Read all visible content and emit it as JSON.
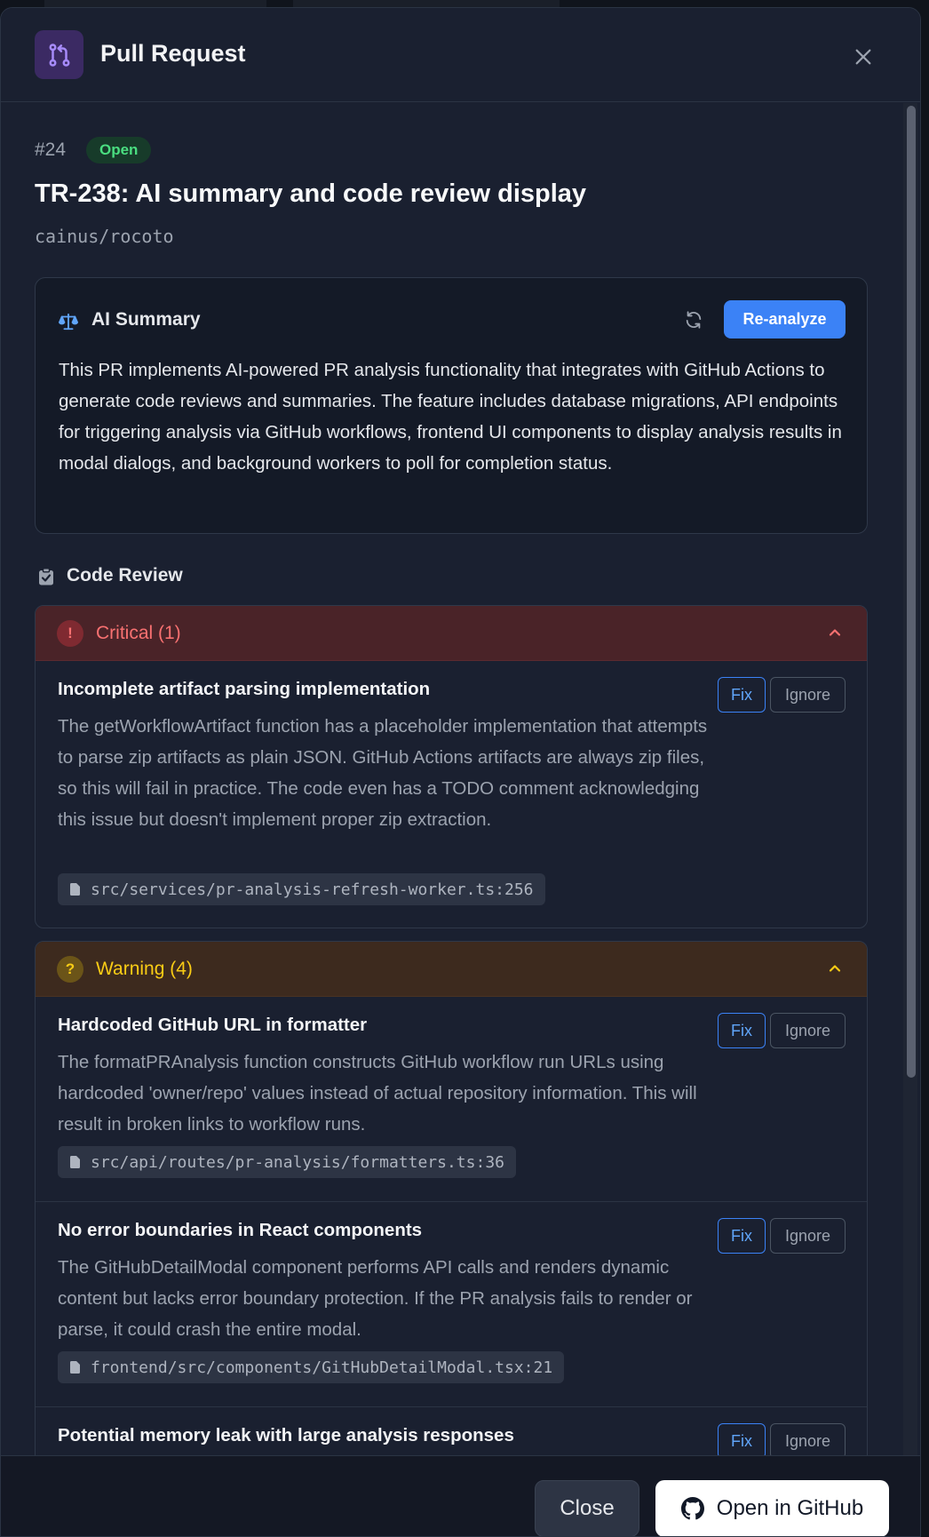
{
  "colors": {
    "accent": "#3b82f6",
    "critical": "#f87171",
    "warning": "#facc15",
    "open_badge": "#4ade80",
    "modal_bg": "#1a2030"
  },
  "header": {
    "title": "Pull Request",
    "icon": "git-pull-request-icon",
    "close_icon": "close-icon"
  },
  "pr": {
    "number": "#24",
    "status": "Open",
    "title": "TR-238: AI summary and code review display",
    "repo": "cainus/rocoto"
  },
  "ai_summary": {
    "icon": "scale-icon",
    "title": "AI Summary",
    "refresh_icon": "refresh-icon",
    "reanalyze_label": "Re-analyze",
    "text": "This PR implements AI-powered PR analysis functionality that integrates with GitHub Actions to generate code reviews and summaries. The feature includes database migrations, API endpoints for triggering analysis via GitHub workflows, frontend UI components to display analysis results in modal dialogs, and background workers to poll for completion status."
  },
  "code_review": {
    "icon": "clipboard-check-icon",
    "title": "Code Review",
    "groups": [
      {
        "severity": "critical",
        "label": "Critical (1)",
        "symbol": "!",
        "issues": [
          {
            "title": "Incomplete artifact parsing implementation",
            "description": "The getWorkflowArtifact function has a placeholder implementation that attempts to parse zip artifacts as plain JSON. GitHub Actions artifacts are always zip files, so this will fail in practice. The code even has a TODO comment acknowledging this issue but doesn't implement proper zip extraction.",
            "file": "src/services/pr-analysis-refresh-worker.ts:256",
            "fix_label": "Fix",
            "ignore_label": "Ignore"
          }
        ]
      },
      {
        "severity": "warning",
        "label": "Warning (4)",
        "symbol": "?",
        "issues": [
          {
            "title": "Hardcoded GitHub URL in formatter",
            "description": "The formatPRAnalysis function constructs GitHub workflow run URLs using hardcoded 'owner/repo' values instead of actual repository information. This will result in broken links to workflow runs.",
            "file": "src/api/routes/pr-analysis/formatters.ts:36",
            "fix_label": "Fix",
            "ignore_label": "Ignore"
          },
          {
            "title": "No error boundaries in React components",
            "description": "The GitHubDetailModal component performs API calls and renders dynamic content but lacks error boundary protection. If the PR analysis fails to render or parse, it could crash the entire modal.",
            "file": "frontend/src/components/GitHubDetailModal.tsx:21",
            "fix_label": "Fix",
            "ignore_label": "Ignore"
          },
          {
            "title": "Potential memory leak with large analysis responses",
            "fix_label": "Fix",
            "ignore_label": "Ignore"
          }
        ]
      }
    ]
  },
  "footer": {
    "close_label": "Close",
    "github_label": "Open in GitHub",
    "github_icon": "github-icon"
  }
}
